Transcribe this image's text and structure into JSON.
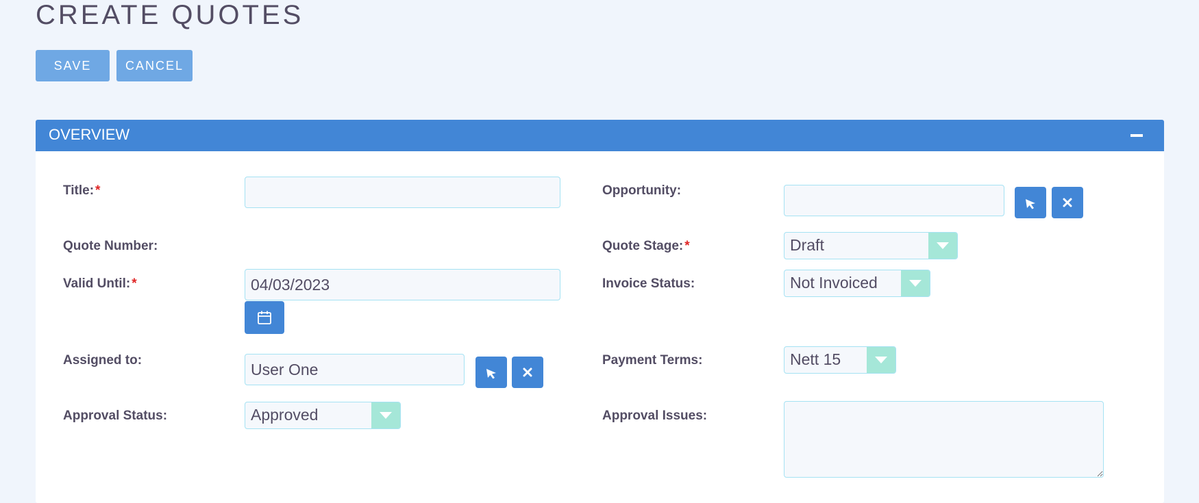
{
  "page": {
    "title": "CREATE QUOTES"
  },
  "actions": {
    "save_label": "SAVE",
    "cancel_label": "CANCEL"
  },
  "panel": {
    "title": "OVERVIEW"
  },
  "fields": {
    "title": {
      "label": "Title:",
      "required_mark": "*",
      "value": ""
    },
    "quote_number": {
      "label": "Quote Number:"
    },
    "valid_until": {
      "label": "Valid Until:",
      "required_mark": "*",
      "value": "04/03/2023"
    },
    "assigned_to": {
      "label": "Assigned to:",
      "value": "User One"
    },
    "approval_status": {
      "label": "Approval Status:",
      "value": "Approved"
    },
    "opportunity": {
      "label": "Opportunity:",
      "value": ""
    },
    "quote_stage": {
      "label": "Quote Stage:",
      "required_mark": "*",
      "value": "Draft"
    },
    "invoice_status": {
      "label": "Invoice Status:",
      "value": "Not Invoiced"
    },
    "payment_terms": {
      "label": "Payment Terms:",
      "value": "Nett 15"
    },
    "approval_issues": {
      "label": "Approval Issues:",
      "value": ""
    }
  },
  "icons": {
    "select": "cursor-arrow-icon",
    "clear": "close-icon",
    "calendar": "calendar-icon",
    "collapse": "minus-icon",
    "dropdown": "chevron-down-icon"
  },
  "colors": {
    "background": "#f0f5fc",
    "primary": "#4286d6",
    "top_button": "#6fa8e4",
    "dropdown_accent": "#a5e7d8",
    "input_border": "#a5e2f3",
    "required": "#e02626",
    "text": "#534d64"
  }
}
